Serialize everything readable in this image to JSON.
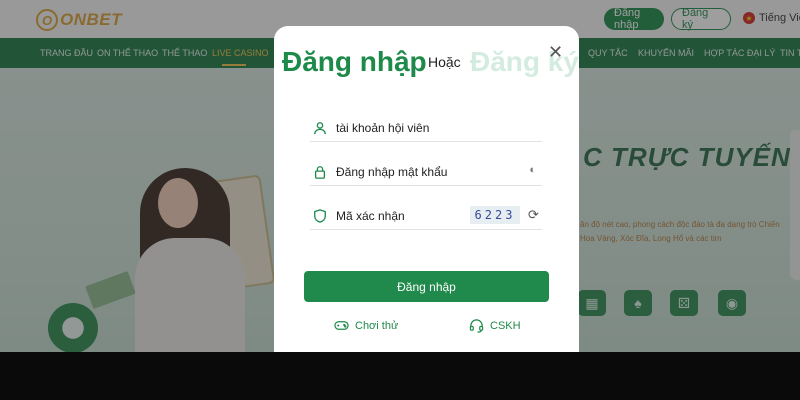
{
  "header": {
    "logo_text": "ONBET",
    "login_label": "Đăng nhập",
    "register_label": "Đăng ký",
    "language": "Tiếng Việt"
  },
  "nav": {
    "items": [
      "TRANG ĐẦU",
      "ON THỂ THAO",
      "THỂ THAO",
      "LIVE CASINO",
      "QUY TẮC",
      "KHUYẾN MÃI",
      "HỢP TÁC ĐẠI LÝ",
      "TIN TỨC"
    ],
    "active": "LIVE CASINO"
  },
  "banner": {
    "title": "C TRỰC TUYẾN",
    "subtitle": "ăn độ nét cao, phong cách độc đáo tà đa dạng trò Chiến Hoa Vàng, Xóc Đĩa, Long Hổ và các tim"
  },
  "modal": {
    "login_title": "Đăng nhập",
    "or_label": "Hoặc",
    "register_title": "Đăng ký",
    "username_placeholder": "tài khoản hội viên",
    "password_placeholder": "Đăng nhập mật khẩu",
    "captcha_label": "Mã xác nhận",
    "captcha_code": "6223",
    "submit_label": "Đăng nhập",
    "trial_label": "Chơi thử",
    "support_label": "CSKH"
  },
  "colors": {
    "brand_green": "#1f8a4c",
    "accent_gold": "#d9a23a",
    "register_faded": "#d4ece0"
  }
}
